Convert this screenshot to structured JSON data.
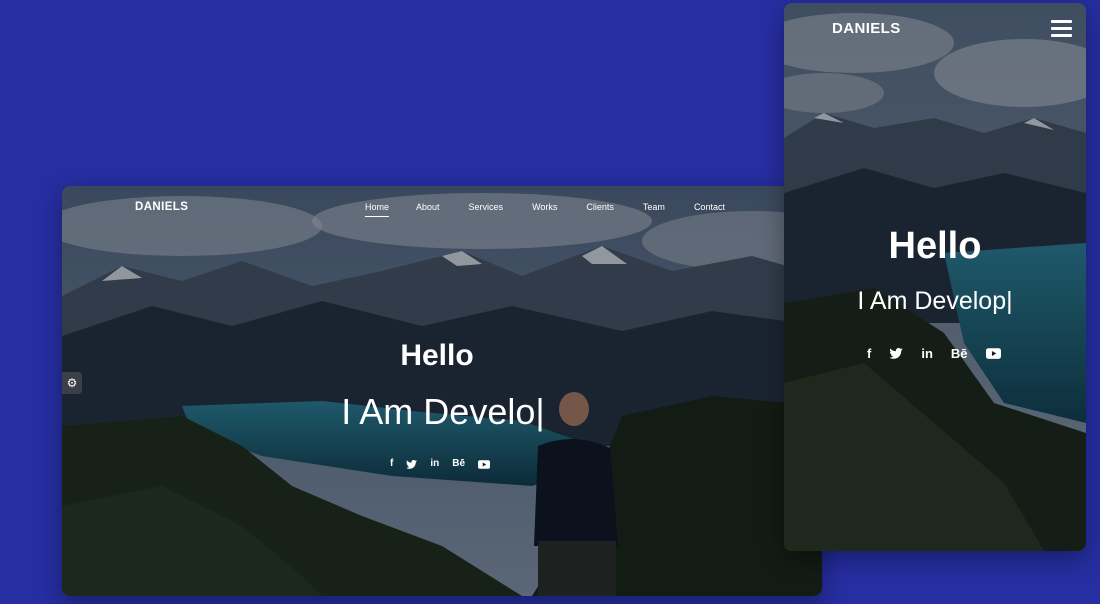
{
  "desktop": {
    "brand": "DANIELS",
    "nav": [
      "Home",
      "About",
      "Services",
      "Works",
      "Clients",
      "Team",
      "Contact"
    ],
    "active_nav": "Home",
    "hero": {
      "greeting": "Hello",
      "role_prefix": "I Am ",
      "role_typed": "Develo|"
    },
    "social": [
      {
        "icon": "facebook-icon",
        "glyph": "f"
      },
      {
        "icon": "twitter-icon",
        "glyph": ""
      },
      {
        "icon": "linkedin-icon",
        "glyph": "in"
      },
      {
        "icon": "behance-icon",
        "glyph": "Bē"
      },
      {
        "icon": "youtube-icon",
        "glyph": ""
      }
    ],
    "settings_icon": "gear-icon"
  },
  "mobile": {
    "brand": "DANIELS",
    "menu_icon": "hamburger-icon",
    "hero": {
      "greeting": "Hello",
      "role_prefix": "I Am ",
      "role_typed": "Develop|"
    },
    "social": [
      {
        "icon": "facebook-icon",
        "glyph": "f"
      },
      {
        "icon": "twitter-icon",
        "glyph": ""
      },
      {
        "icon": "linkedin-icon",
        "glyph": "in"
      },
      {
        "icon": "behance-icon",
        "glyph": "Bē"
      },
      {
        "icon": "youtube-icon",
        "glyph": ""
      }
    ]
  },
  "colors": {
    "page_background": "#262ea1",
    "text": "#ffffff"
  }
}
